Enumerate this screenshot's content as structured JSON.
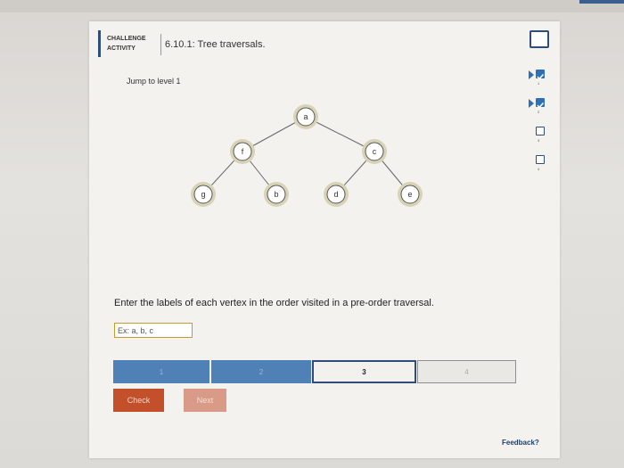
{
  "activity": {
    "badge": [
      "CHALLENGE",
      "ACTIVITY"
    ],
    "title": "6.10.1: Tree traversals.",
    "jump_label": "Jump to level 1"
  },
  "tree": {
    "nodes": [
      "a",
      "f",
      "c",
      "g",
      "b",
      "d",
      "e"
    ],
    "edges": [
      [
        "a",
        "f"
      ],
      [
        "a",
        "c"
      ],
      [
        "f",
        "g"
      ],
      [
        "f",
        "b"
      ],
      [
        "c",
        "d"
      ],
      [
        "c",
        "e"
      ]
    ]
  },
  "question": {
    "prompt": "Enter the labels of each vertex in the order visited in a pre-order traversal.",
    "answer_value": "",
    "answer_placeholder": "Ex: a, b, c"
  },
  "progress": {
    "levels": [
      "1",
      "2",
      "3",
      "4"
    ],
    "completed": 2,
    "current": 3
  },
  "buttons": {
    "check": "Check",
    "next": "Next"
  },
  "feedback_link": "Feedback?",
  "level_checklist": [
    {
      "label": "1",
      "status": "checked"
    },
    {
      "label": "2",
      "status": "checked"
    },
    {
      "label": "3",
      "status": "empty"
    },
    {
      "label": "4",
      "status": "empty"
    }
  ],
  "colors": {
    "accent": "#2e4d7a",
    "progress_done": "#4f80b6",
    "check_button": "#c44f2b",
    "next_button": "#d99b87",
    "answer_border": "#c79a2b",
    "node_ring": "#d8d3b6"
  }
}
